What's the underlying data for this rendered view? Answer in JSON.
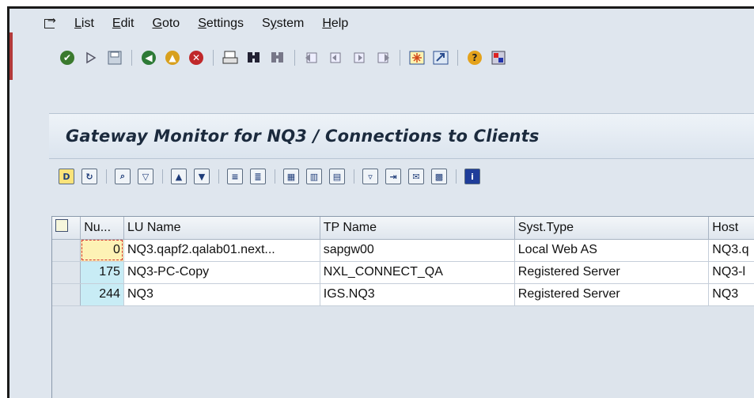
{
  "menu": {
    "items": [
      {
        "label": "List",
        "ul": "L",
        "rest": "ist"
      },
      {
        "label": "Edit",
        "ul": "E",
        "rest": "dit"
      },
      {
        "label": "Goto",
        "ul": "G",
        "rest": "oto"
      },
      {
        "label": "Settings",
        "ul": "S",
        "rest": "ettings"
      },
      {
        "label": "System",
        "pre": "S",
        "ul": "y",
        "rest": "stem"
      },
      {
        "label": "Help",
        "ul": "H",
        "rest": "elp"
      }
    ]
  },
  "title": "Gateway Monitor for NQ3 / Connections to Clients",
  "table": {
    "columns": [
      "Nu...",
      "LU Name",
      "TP Name",
      "Syst.Type",
      "Host"
    ],
    "rows": [
      {
        "nu": "0",
        "lu": "NQ3.qapf2.qalab01.next...",
        "tp": "sapgw00",
        "type": "Local Web AS",
        "host": "NQ3.q"
      },
      {
        "nu": "175",
        "lu": "NQ3-PC-Copy",
        "tp": "NXL_CONNECT_QA",
        "type": "Registered Server",
        "host": "NQ3-l"
      },
      {
        "nu": "244",
        "lu": "NQ3",
        "tp": "IGS.NQ3",
        "type": "Registered Server",
        "host": "NQ3"
      }
    ]
  },
  "colors": {
    "title_bg": "#dbe4ee",
    "num_cell": "#c8ecf5",
    "active_cell": "#fdf2b5"
  },
  "icons": [
    "enter-icon",
    "save-icon",
    "back-icon",
    "exit-icon",
    "cancel-icon",
    "print-icon",
    "find-icon",
    "help-icon"
  ]
}
